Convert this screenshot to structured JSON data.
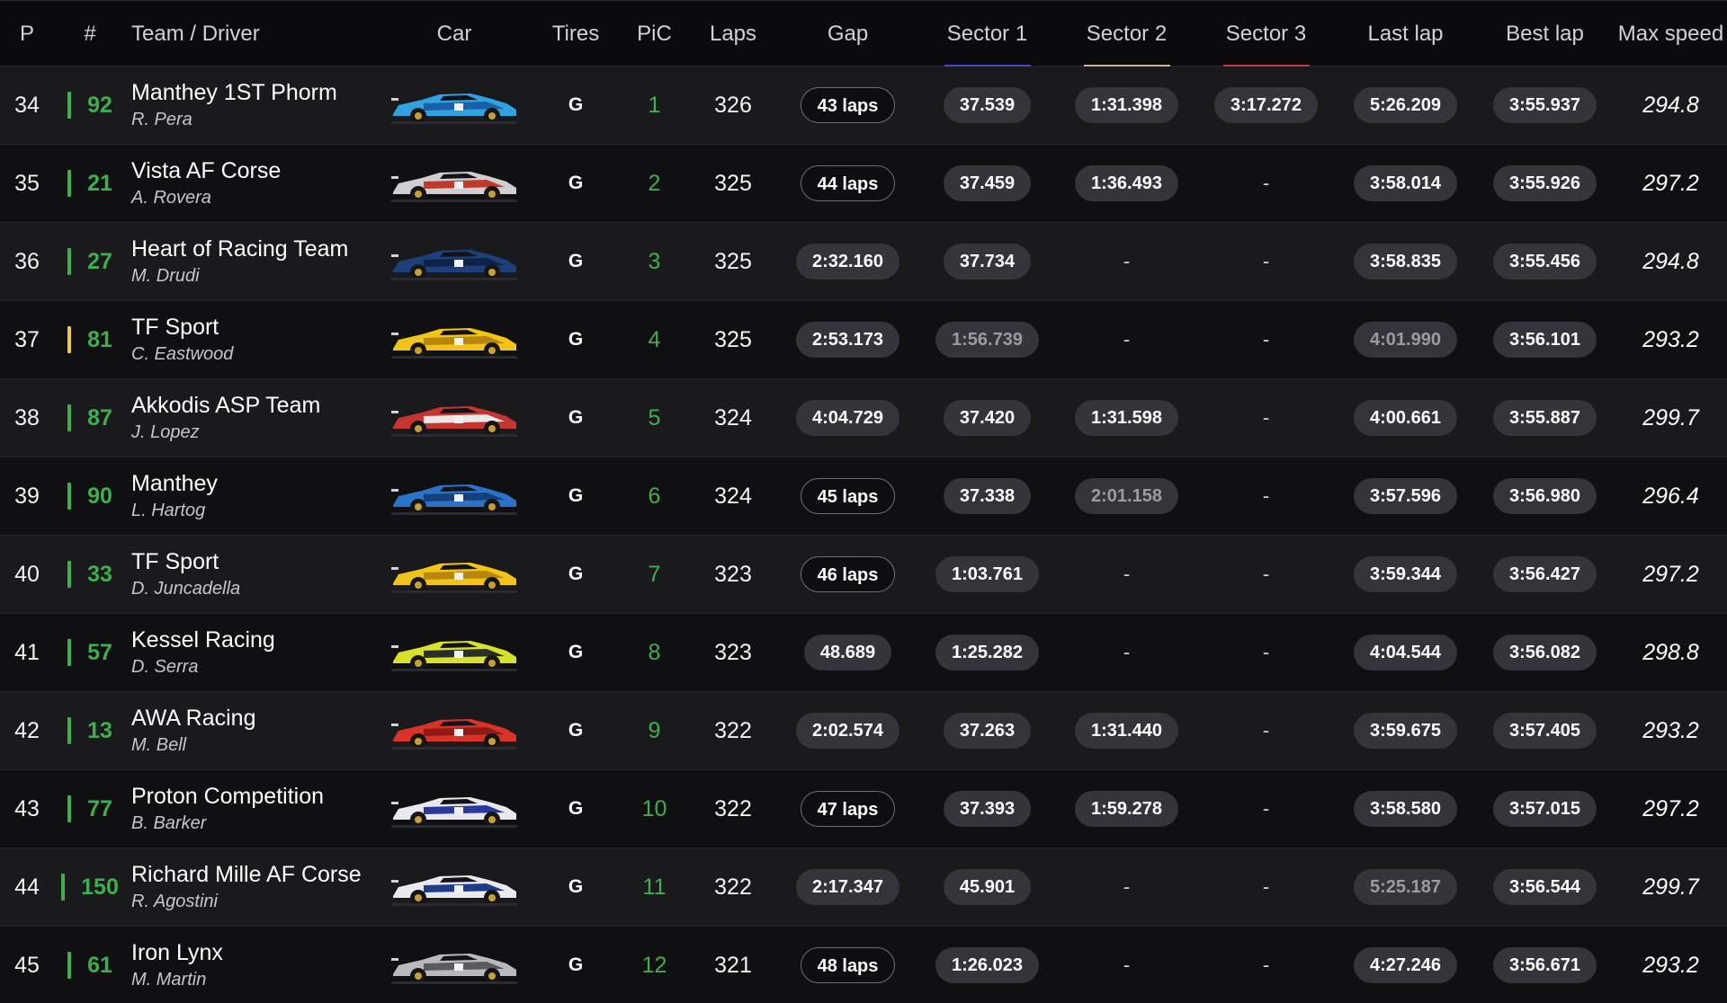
{
  "header": {
    "p": "P",
    "num": "#",
    "team_driver": "Team / Driver",
    "car": "Car",
    "tires": "Tires",
    "pic": "PiC",
    "laps": "Laps",
    "gap": "Gap",
    "sector1": "Sector 1",
    "sector2": "Sector 2",
    "sector3": "Sector 3",
    "last_lap": "Last lap",
    "best_lap": "Best lap",
    "max_speed": "Max speed"
  },
  "colors": {
    "class_green": "#3fae4d",
    "flag_yellow": "#f0c84a",
    "sector1_underline": "#4b47c9",
    "sector2_underline": "#c9b49a",
    "sector3_underline": "#c23a4a"
  },
  "rows": [
    {
      "pos": "34",
      "num": "92",
      "status": "green",
      "team": "Manthey 1ST Phorm",
      "driver": "R. Pera",
      "car_colors": [
        "#2fa3df",
        "#1b5fa8"
      ],
      "tires": "G",
      "pic": "1",
      "laps": "326",
      "gap": "43 laps",
      "gap_style": "outline",
      "s1": "37.539",
      "s1_dim": false,
      "s2": "1:31.398",
      "s2_dim": false,
      "s3": "3:17.272",
      "s3_dim": false,
      "last": "5:26.209",
      "last_dim": false,
      "best": "3:55.937",
      "speed": "294.8"
    },
    {
      "pos": "35",
      "num": "21",
      "status": "green",
      "team": "Vista AF Corse",
      "driver": "A. Rovera",
      "car_colors": [
        "#cfcfd2",
        "#c0392b"
      ],
      "tires": "G",
      "pic": "2",
      "laps": "325",
      "gap": "44 laps",
      "gap_style": "outline",
      "s1": "37.459",
      "s1_dim": false,
      "s2": "1:36.493",
      "s2_dim": false,
      "s3": "-",
      "s3_dim": false,
      "last": "3:58.014",
      "last_dim": false,
      "best": "3:55.926",
      "speed": "297.2"
    },
    {
      "pos": "36",
      "num": "27",
      "status": "green",
      "team": "Heart of Racing Team",
      "driver": "M. Drudi",
      "car_colors": [
        "#1d3f7a",
        "#0f2247"
      ],
      "tires": "G",
      "pic": "3",
      "laps": "325",
      "gap": "2:32.160",
      "gap_style": "filled",
      "s1": "37.734",
      "s1_dim": false,
      "s2": "-",
      "s2_dim": false,
      "s3": "-",
      "s3_dim": false,
      "last": "3:58.835",
      "last_dim": false,
      "best": "3:55.456",
      "speed": "294.8"
    },
    {
      "pos": "37",
      "num": "81",
      "status": "yellow",
      "team": "TF Sport",
      "driver": "C. Eastwood",
      "car_colors": [
        "#f2c318",
        "#b8860b"
      ],
      "tires": "G",
      "pic": "4",
      "laps": "325",
      "gap": "2:53.173",
      "gap_style": "filled",
      "s1": "1:56.739",
      "s1_dim": true,
      "s2": "-",
      "s2_dim": false,
      "s3": "-",
      "s3_dim": false,
      "last": "4:01.990",
      "last_dim": true,
      "best": "3:56.101",
      "speed": "293.2"
    },
    {
      "pos": "38",
      "num": "87",
      "status": "green",
      "team": "Akkodis ASP Team",
      "driver": "J. Lopez",
      "car_colors": [
        "#c73530",
        "#e9e9ea"
      ],
      "tires": "G",
      "pic": "5",
      "laps": "324",
      "gap": "4:04.729",
      "gap_style": "filled",
      "s1": "37.420",
      "s1_dim": false,
      "s2": "1:31.598",
      "s2_dim": false,
      "s3": "-",
      "s3_dim": false,
      "last": "4:00.661",
      "last_dim": false,
      "best": "3:55.887",
      "speed": "299.7"
    },
    {
      "pos": "39",
      "num": "90",
      "status": "green",
      "team": "Manthey",
      "driver": "L. Hartog",
      "car_colors": [
        "#2a73c9",
        "#14407e"
      ],
      "tires": "G",
      "pic": "6",
      "laps": "324",
      "gap": "45 laps",
      "gap_style": "outline",
      "s1": "37.338",
      "s1_dim": false,
      "s2": "2:01.158",
      "s2_dim": true,
      "s3": "-",
      "s3_dim": false,
      "last": "3:57.596",
      "last_dim": false,
      "best": "3:56.980",
      "speed": "296.4"
    },
    {
      "pos": "40",
      "num": "33",
      "status": "green",
      "team": "TF Sport",
      "driver": "D. Juncadella",
      "car_colors": [
        "#f2c318",
        "#b8860b"
      ],
      "tires": "G",
      "pic": "7",
      "laps": "323",
      "gap": "46 laps",
      "gap_style": "outline",
      "s1": "1:03.761",
      "s1_dim": false,
      "s2": "-",
      "s2_dim": false,
      "s3": "-",
      "s3_dim": false,
      "last": "3:59.344",
      "last_dim": false,
      "best": "3:56.427",
      "speed": "297.2"
    },
    {
      "pos": "41",
      "num": "57",
      "status": "green",
      "team": "Kessel Racing",
      "driver": "D. Serra",
      "car_colors": [
        "#d7e02a",
        "#2b2f2a"
      ],
      "tires": "G",
      "pic": "8",
      "laps": "323",
      "gap": "48.689",
      "gap_style": "filled",
      "s1": "1:25.282",
      "s1_dim": false,
      "s2": "-",
      "s2_dim": false,
      "s3": "-",
      "s3_dim": false,
      "last": "4:04.544",
      "last_dim": false,
      "best": "3:56.082",
      "speed": "298.8"
    },
    {
      "pos": "42",
      "num": "13",
      "status": "green",
      "team": "AWA Racing",
      "driver": "M. Bell",
      "car_colors": [
        "#d93328",
        "#8e1a14"
      ],
      "tires": "G",
      "pic": "9",
      "laps": "322",
      "gap": "2:02.574",
      "gap_style": "filled",
      "s1": "37.263",
      "s1_dim": false,
      "s2": "1:31.440",
      "s2_dim": false,
      "s3": "-",
      "s3_dim": false,
      "last": "3:59.675",
      "last_dim": false,
      "best": "3:57.405",
      "speed": "293.2"
    },
    {
      "pos": "43",
      "num": "77",
      "status": "green",
      "team": "Proton Competition",
      "driver": "B. Barker",
      "car_colors": [
        "#e8e8ee",
        "#2a3a9a"
      ],
      "tires": "G",
      "pic": "10",
      "laps": "322",
      "gap": "47 laps",
      "gap_style": "outline",
      "s1": "37.393",
      "s1_dim": false,
      "s2": "1:59.278",
      "s2_dim": false,
      "s3": "-",
      "s3_dim": false,
      "last": "3:58.580",
      "last_dim": false,
      "best": "3:57.015",
      "speed": "297.2"
    },
    {
      "pos": "44",
      "num": "150",
      "status": "green",
      "team": "Richard Mille AF Corse",
      "driver": "R. Agostini",
      "car_colors": [
        "#e9e9ee",
        "#1f3c8a"
      ],
      "tires": "G",
      "pic": "11",
      "laps": "322",
      "gap": "2:17.347",
      "gap_style": "filled",
      "s1": "45.901",
      "s1_dim": false,
      "s2": "-",
      "s2_dim": false,
      "s3": "-",
      "s3_dim": false,
      "last": "5:25.187",
      "last_dim": true,
      "best": "3:56.544",
      "speed": "299.7"
    },
    {
      "pos": "45",
      "num": "61",
      "status": "green",
      "team": "Iron Lynx",
      "driver": "M. Martin",
      "car_colors": [
        "#b9babe",
        "#5a5b60"
      ],
      "tires": "G",
      "pic": "12",
      "laps": "321",
      "gap": "48 laps",
      "gap_style": "outline",
      "s1": "1:26.023",
      "s1_dim": false,
      "s2": "-",
      "s2_dim": false,
      "s3": "-",
      "s3_dim": false,
      "last": "4:27.246",
      "last_dim": false,
      "best": "3:56.671",
      "speed": "293.2"
    }
  ]
}
